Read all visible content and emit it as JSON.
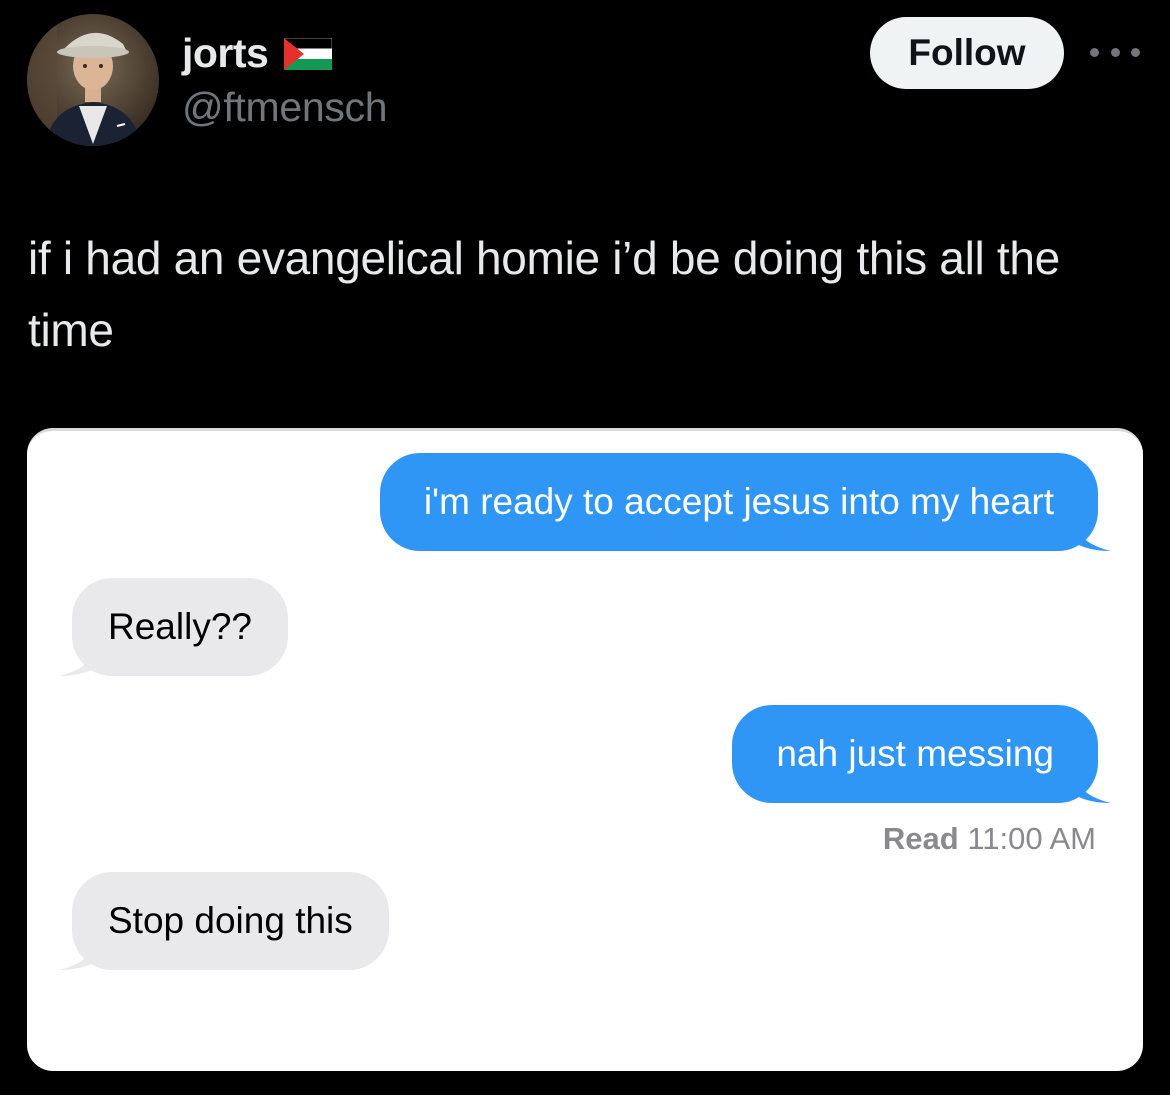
{
  "header": {
    "display_name": "jorts",
    "handle": "@ftmensch",
    "follow_label": "Follow",
    "more_icon": "ellipsis-icon",
    "flag_icon": "palestine-flag-icon",
    "avatar_icon": "profile-avatar"
  },
  "tweet": {
    "text": "if i had an evangelical homie i’d be doing this all the time"
  },
  "conversation": {
    "messages": [
      {
        "sender": "me",
        "text": "i'm ready to accept jesus into my heart"
      },
      {
        "sender": "them",
        "text": "Really??"
      },
      {
        "sender": "me",
        "text": "nah just messing"
      },
      {
        "sender": "them",
        "text": "Stop doing this"
      }
    ],
    "read_label": "Read",
    "read_time": "11:00 AM"
  },
  "colors": {
    "background": "#000000",
    "sent_bubble": "#2f96f6",
    "received_bubble": "#e9e9eb",
    "follow_button": "#eff3f4",
    "secondary_text": "#71767b"
  }
}
